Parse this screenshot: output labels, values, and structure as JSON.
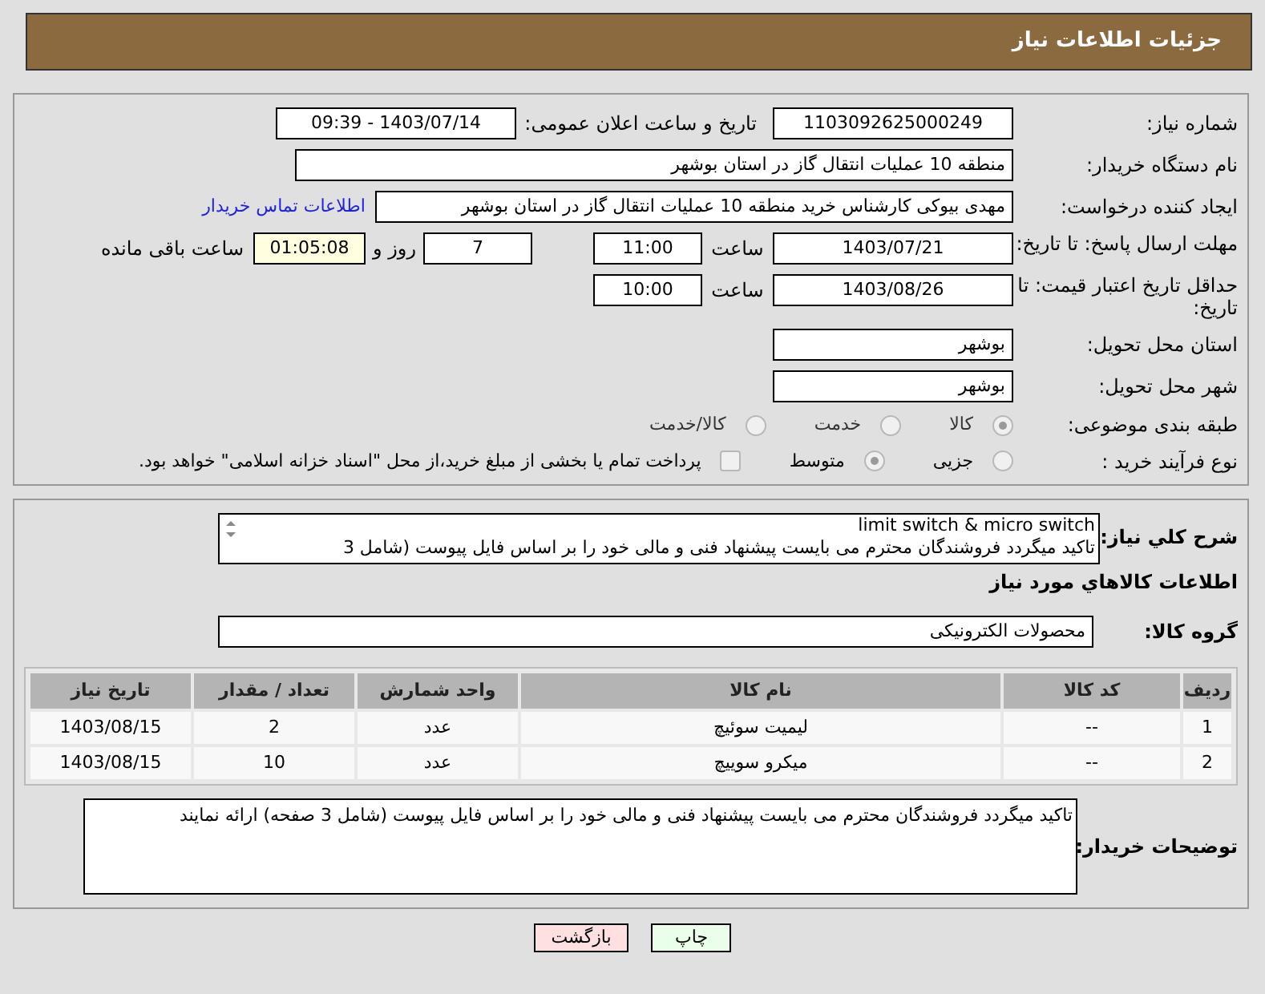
{
  "header": {
    "title": "جزئیات اطلاعات نیاز"
  },
  "need_number": {
    "label": "شماره نیاز:",
    "value": "1103092625000249"
  },
  "announce": {
    "label": "تاریخ و ساعت اعلان عمومی:",
    "value": "1403/07/14 - 09:39"
  },
  "buyer_org": {
    "label": "نام دستگاه خریدار:",
    "value": "منطقه 10 عملیات انتقال گاز در استان بوشهر"
  },
  "requester": {
    "label": "ایجاد کننده درخواست:",
    "value": "مهدی بیوکی کارشناس خرید منطقه 10 عملیات انتقال گاز در استان بوشهر",
    "link": "اطلاعات تماس خریدار"
  },
  "response_deadline": {
    "label": "مهلت ارسال پاسخ: تا تاریخ:",
    "date": "1403/07/21",
    "time_label": "ساعت",
    "time": "11:00",
    "days": "7",
    "days_label": "روز و",
    "remaining": "01:05:08",
    "remaining_label": "ساعت باقی مانده"
  },
  "price_validity": {
    "label": "حداقل تاریخ اعتبار قیمت: تا تاریخ:",
    "date": "1403/08/26",
    "time_label": "ساعت",
    "time": "10:00"
  },
  "province": {
    "label": "استان محل تحویل:",
    "value": "بوشهر"
  },
  "city": {
    "label": "شهر محل تحویل:",
    "value": "بوشهر"
  },
  "category": {
    "label": "طبقه بندی موضوعی:",
    "options": [
      {
        "label": "کالا",
        "selected": true
      },
      {
        "label": "خدمت",
        "selected": false
      },
      {
        "label": "کالا/خدمت",
        "selected": false
      }
    ]
  },
  "process": {
    "label": "نوع فرآیند خرید :",
    "options": [
      {
        "label": "جزیی",
        "selected": false
      },
      {
        "label": "متوسط",
        "selected": true
      }
    ],
    "treasury": {
      "label": "پرداخت تمام یا بخشی از مبلغ خرید،از محل \"اسناد خزانه اسلامی\" خواهد بود.",
      "checked": false
    }
  },
  "description": {
    "label": "شرح کلي نیاز:",
    "lines": [
      "limit switch & micro switch",
      "تاکید میگردد فروشندگان محترم می بایست پیشنهاد فنی و مالی خود را بر اساس فایل پیوست (شامل 3"
    ]
  },
  "goods_heading": "اطلاعات کالاهاي مورد نیاز",
  "goods_group": {
    "label": "گروه کالا:",
    "value": "محصولات الکترونیکی"
  },
  "table": {
    "columns": [
      "ردیف",
      "کد کالا",
      "نام کالا",
      "واحد شمارش",
      "تعداد / مقدار",
      "تاریخ نیاز"
    ],
    "rows": [
      [
        "1",
        "--",
        "لیمیت سوئیچ",
        "عدد",
        "2",
        "1403/08/15"
      ],
      [
        "2",
        "--",
        "میکرو سوییچ",
        "عدد",
        "10",
        "1403/08/15"
      ]
    ]
  },
  "buyer_notes": {
    "label": "توضیحات خریدار:",
    "value": "تاکید میگردد فروشندگان محترم می بایست پیشنهاد فنی و مالی خود را بر اساس فایل پیوست (شامل 3 صفحه) ارائه نمایند"
  },
  "buttons": [
    {
      "label": "چاپ",
      "color": "#eaffea"
    },
    {
      "label": "بازگشت",
      "color": "#ffe0e0"
    }
  ]
}
